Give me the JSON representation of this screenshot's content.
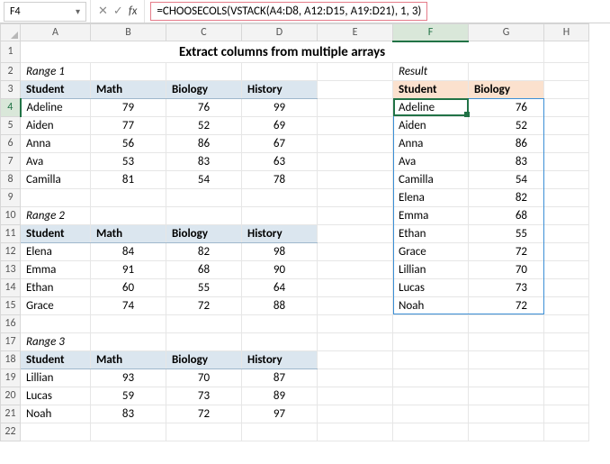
{
  "nameBox": {
    "value": "F4"
  },
  "formulaBar": {
    "formula": "=CHOOSECOLS(VSTACK(A4:D8, A12:D15, A19:D21), 1, 3)"
  },
  "columns": [
    "A",
    "B",
    "C",
    "D",
    "E",
    "F",
    "G",
    "H"
  ],
  "rows": [
    "1",
    "2",
    "3",
    "4",
    "5",
    "6",
    "7",
    "8",
    "9",
    "10",
    "11",
    "12",
    "13",
    "14",
    "15",
    "16",
    "17",
    "18",
    "19",
    "20",
    "21",
    "22"
  ],
  "activeCol": "F",
  "activeRow": "4",
  "title": "Extract columns from multiple arrays",
  "range1": {
    "label": "Range 1",
    "headers": {
      "student": "Student",
      "math": "Math",
      "biology": "Biology",
      "history": "History"
    },
    "rows": [
      {
        "student": "Adeline",
        "math": "79",
        "biology": "76",
        "history": "99"
      },
      {
        "student": "Aiden",
        "math": "77",
        "biology": "52",
        "history": "69"
      },
      {
        "student": "Anna",
        "math": "56",
        "biology": "86",
        "history": "67"
      },
      {
        "student": "Ava",
        "math": "53",
        "biology": "83",
        "history": "63"
      },
      {
        "student": "Camilla",
        "math": "81",
        "biology": "54",
        "history": "78"
      }
    ]
  },
  "range2": {
    "label": "Range 2",
    "headers": {
      "student": "Student",
      "math": "Math",
      "biology": "Biology",
      "history": "History"
    },
    "rows": [
      {
        "student": "Elena",
        "math": "84",
        "biology": "82",
        "history": "98"
      },
      {
        "student": "Emma",
        "math": "91",
        "biology": "68",
        "history": "90"
      },
      {
        "student": "Ethan",
        "math": "60",
        "biology": "55",
        "history": "64"
      },
      {
        "student": "Grace",
        "math": "74",
        "biology": "72",
        "history": "88"
      }
    ]
  },
  "range3": {
    "label": "Range 3",
    "headers": {
      "student": "Student",
      "math": "Math",
      "biology": "Biology",
      "history": "History"
    },
    "rows": [
      {
        "student": "Lillian",
        "math": "93",
        "biology": "70",
        "history": "87"
      },
      {
        "student": "Lucas",
        "math": "59",
        "biology": "73",
        "history": "89"
      },
      {
        "student": "Noah",
        "math": "83",
        "biology": "72",
        "history": "97"
      }
    ]
  },
  "result": {
    "label": "Result",
    "headers": {
      "student": "Student",
      "biology": "Biology"
    },
    "rows": [
      {
        "student": "Adeline",
        "biology": "76"
      },
      {
        "student": "Aiden",
        "biology": "52"
      },
      {
        "student": "Anna",
        "biology": "86"
      },
      {
        "student": "Ava",
        "biology": "83"
      },
      {
        "student": "Camilla",
        "biology": "54"
      },
      {
        "student": "Elena",
        "biology": "82"
      },
      {
        "student": "Emma",
        "biology": "68"
      },
      {
        "student": "Ethan",
        "biology": "55"
      },
      {
        "student": "Grace",
        "biology": "72"
      },
      {
        "student": "Lillian",
        "biology": "70"
      },
      {
        "student": "Lucas",
        "biology": "73"
      },
      {
        "student": "Noah",
        "biology": "72"
      }
    ]
  }
}
